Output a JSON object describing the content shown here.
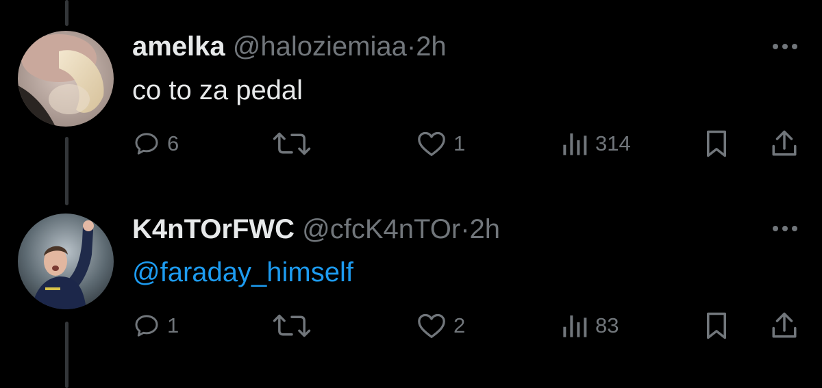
{
  "replies": [
    {
      "name": "amelka",
      "handle": "@haloziemiaa",
      "separator": "·",
      "time": "2h",
      "text": "co to za pedal",
      "reply_count": "6",
      "like_count": "1",
      "view_count": "314",
      "avatar_icon": "avatar-photo"
    },
    {
      "name": "K4nTOrFWC",
      "handle": "@cfcK4nTOr",
      "separator": "·",
      "time": "2h",
      "mention": "@faraday_himself",
      "reply_count": "1",
      "like_count": "2",
      "view_count": "83",
      "avatar_icon": "avatar-photo"
    }
  ],
  "colors": {
    "background": "#000000",
    "primary_text": "#e7e9ea",
    "secondary_text": "#71767b",
    "link": "#1d9bf0",
    "thread_line": "#333639"
  }
}
